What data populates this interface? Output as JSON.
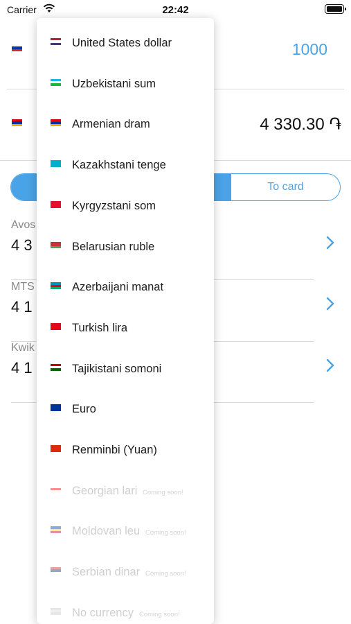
{
  "status_bar": {
    "carrier": "Carrier",
    "time": "22:42"
  },
  "converter": {
    "from_amount": "1000",
    "to_amount": "4 330.30 ֏",
    "to_card_label": "To card"
  },
  "offers": [
    {
      "name": "Avos",
      "value": "4 3"
    },
    {
      "name": "MTS",
      "value": "4 1"
    },
    {
      "name": "Kwik",
      "value": "4 1"
    }
  ],
  "currency_menu": {
    "items": [
      {
        "name": "United States dollar",
        "flag": [
          "#b22234",
          "#ffffff",
          "#3c3b6e"
        ]
      },
      {
        "name": "Uzbekistani sum",
        "flag": [
          "#1eb5e6",
          "#ffffff",
          "#1eb53a"
        ]
      },
      {
        "name": "Armenian dram",
        "flag": [
          "#d90012",
          "#0033a0",
          "#f2a800"
        ]
      },
      {
        "name": "Kazakhstani tenge",
        "flag": [
          "#00afca",
          "#00afca",
          "#00afca"
        ]
      },
      {
        "name": "Kyrgyzstani som",
        "flag": [
          "#e8112d",
          "#e8112d",
          "#e8112d"
        ]
      },
      {
        "name": "Belarusian ruble",
        "flag": [
          "#c8313e",
          "#c8313e",
          "#4aa657"
        ]
      },
      {
        "name": "Azerbaijani manat",
        "flag": [
          "#0092bc",
          "#e4002b",
          "#00af66"
        ]
      },
      {
        "name": "Turkish lira",
        "flag": [
          "#e30a17",
          "#e30a17",
          "#e30a17"
        ]
      },
      {
        "name": "Tajikistani somoni",
        "flag": [
          "#cc0000",
          "#ffffff",
          "#006600"
        ]
      },
      {
        "name": "Euro",
        "flag": [
          "#003399",
          "#003399",
          "#003399"
        ]
      },
      {
        "name": "Renminbi (Yuan)",
        "flag": [
          "#de2910",
          "#de2910",
          "#de2910"
        ]
      }
    ],
    "coming_soon": [
      {
        "name": "Georgian lari",
        "badge": "Coming soon!",
        "flag": [
          "#ffffff",
          "#ff0000",
          "#ffffff"
        ]
      },
      {
        "name": "Moldovan leu",
        "badge": "Coming soon!",
        "flag": [
          "#0046ae",
          "#ffd200",
          "#cc092f"
        ]
      },
      {
        "name": "Serbian dinar",
        "badge": "Coming soon!",
        "flag": [
          "#c6363c",
          "#0c4076",
          "#ffffff"
        ]
      },
      {
        "name": "No currency",
        "badge": "Coming soon!",
        "flag": [
          "#cccccc",
          "#dddddd",
          "#cccccc"
        ]
      }
    ]
  },
  "colors": {
    "accent": "#4aa3e6",
    "divider": "#dadada"
  },
  "icons": {
    "wifi": "wifi-icon",
    "battery": "battery-icon",
    "chevron": "chevron-right-icon"
  }
}
